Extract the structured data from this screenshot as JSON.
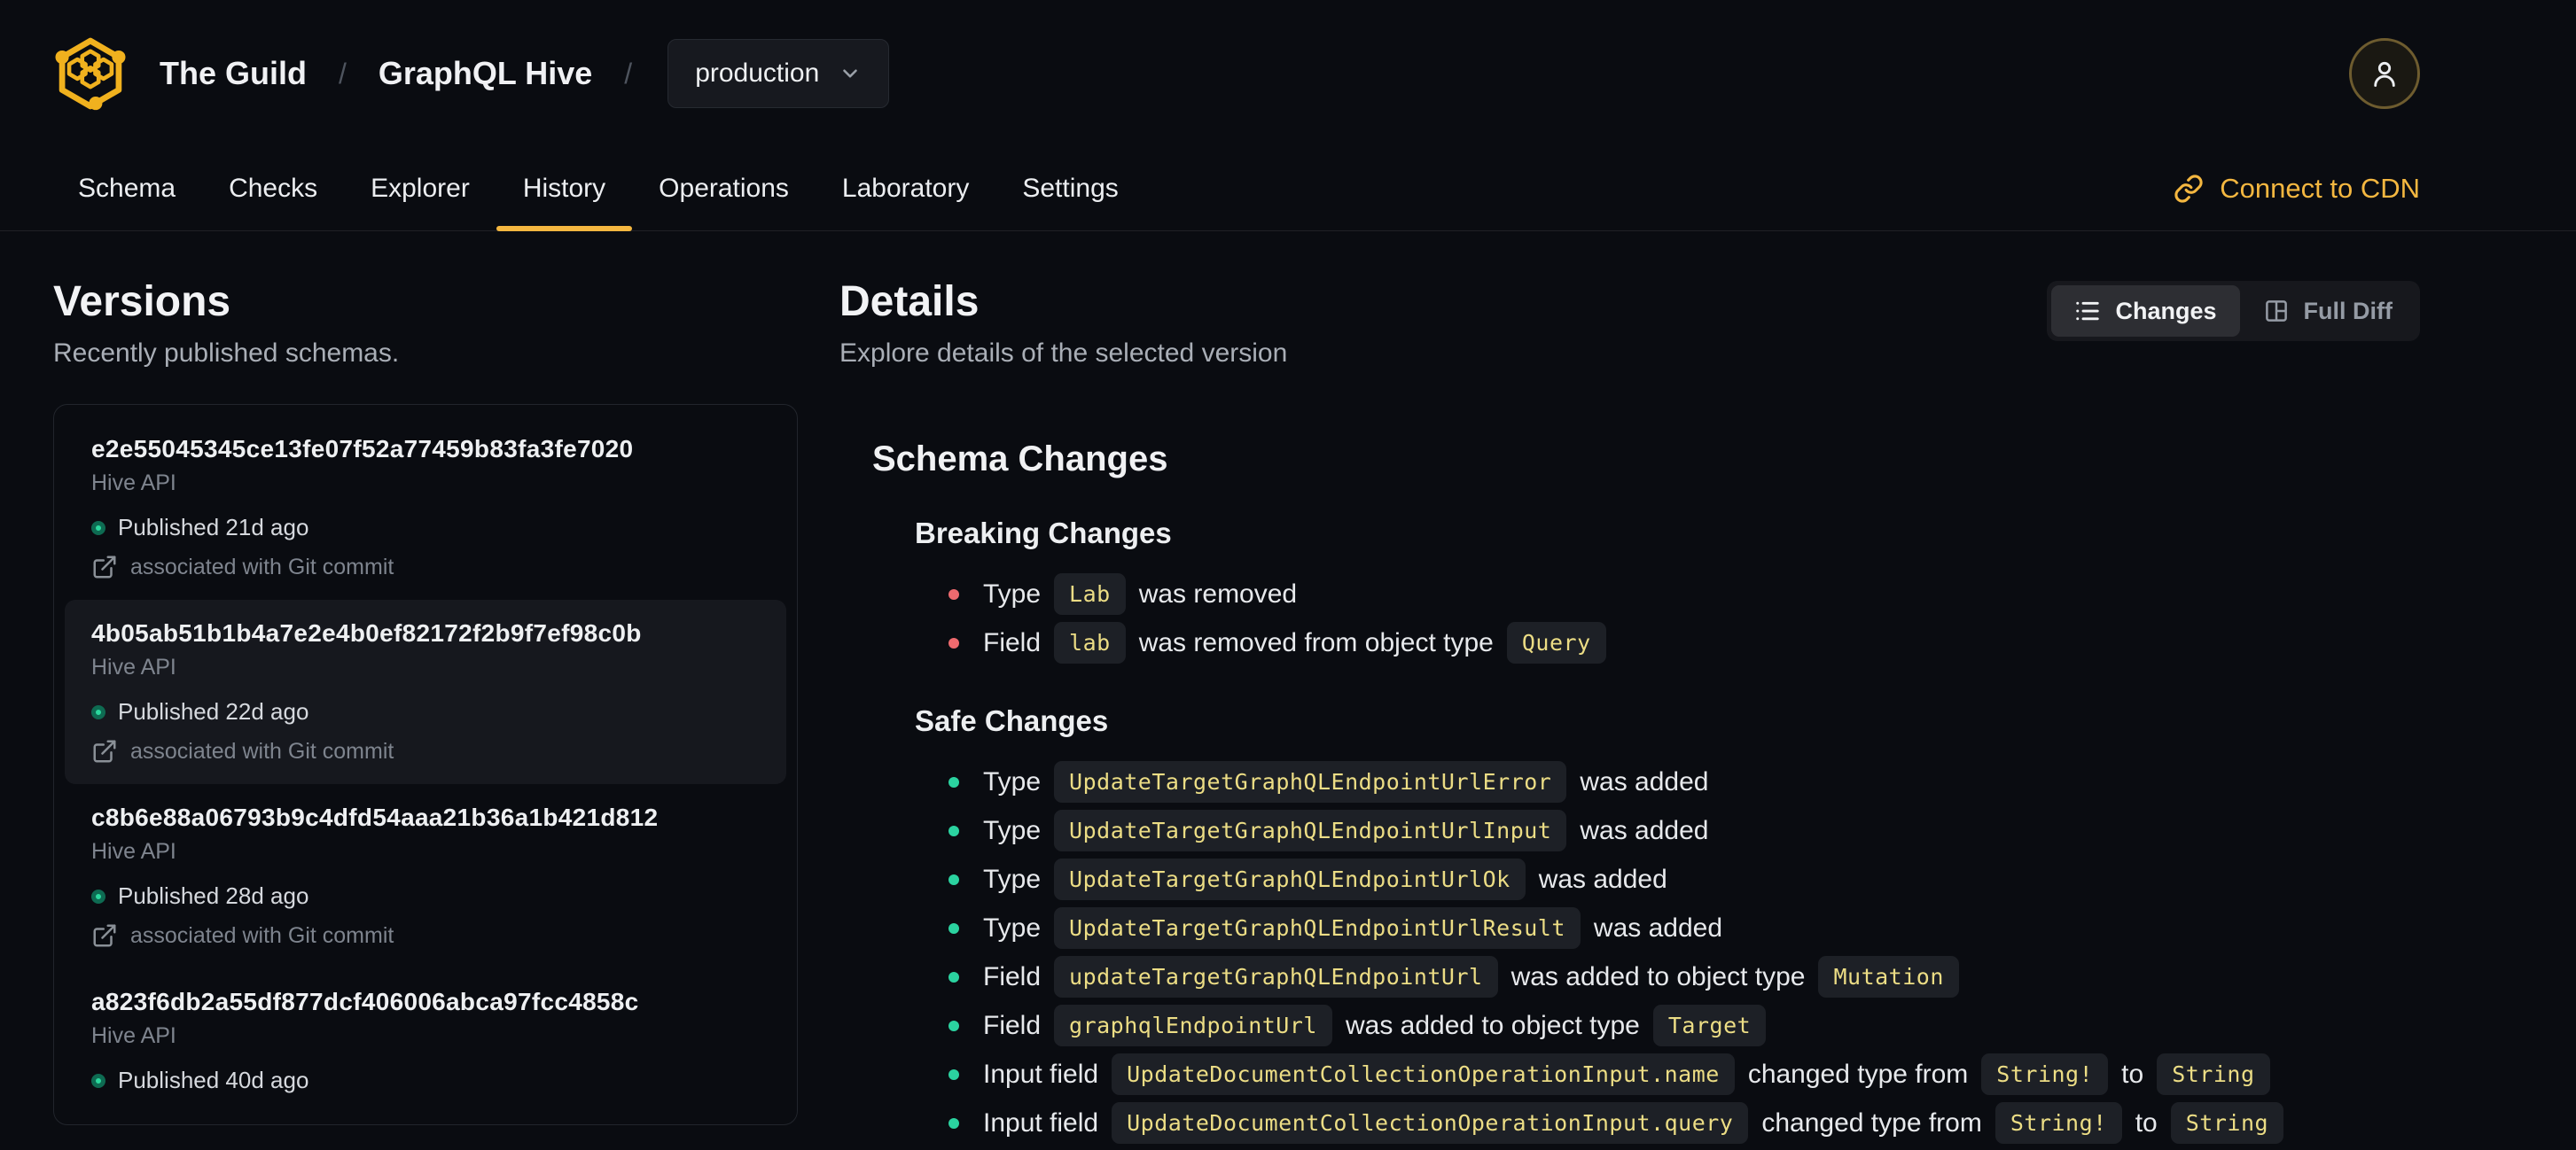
{
  "colors": {
    "accent": "#f4b740",
    "breaking_bullet": "#ee6a6e",
    "safe_bullet": "#2bd3a0",
    "code_text": "#ecdd85",
    "published_dot": "#2bd99e"
  },
  "header": {
    "logo_icon": "hive-logo-icon",
    "breadcrumb": {
      "org": "The Guild",
      "separator": "/",
      "project": "GraphQL Hive",
      "target": {
        "label": "production",
        "icon": "chevron-down-icon"
      }
    },
    "avatar_icon": "user-icon",
    "tabs": [
      {
        "label": "Schema",
        "active": false
      },
      {
        "label": "Checks",
        "active": false
      },
      {
        "label": "Explorer",
        "active": false
      },
      {
        "label": "History",
        "active": true
      },
      {
        "label": "Operations",
        "active": false
      },
      {
        "label": "Laboratory",
        "active": false
      },
      {
        "label": "Settings",
        "active": false
      }
    ],
    "connect_cdn": {
      "label": "Connect to CDN",
      "icon": "link-icon"
    }
  },
  "versions": {
    "title": "Versions",
    "subtitle": "Recently published schemas.",
    "cards": [
      {
        "hash": "e2e55045345ce13fe07f52a77459b83fa3fe7020",
        "service": "Hive API",
        "published": "Published 21d ago",
        "git": "associated with Git commit",
        "selected": false
      },
      {
        "hash": "4b05ab51b1b4a7e2e4b0ef82172f2b9f7ef98c0b",
        "service": "Hive API",
        "published": "Published 22d ago",
        "git": "associated with Git commit",
        "selected": true
      },
      {
        "hash": "c8b6e88a06793b9c4dfd54aaa21b36a1b421d812",
        "service": "Hive API",
        "published": "Published 28d ago",
        "git": "associated with Git commit",
        "selected": false
      },
      {
        "hash": "a823f6db2a55df877dcf406006abca97fcc4858c",
        "service": "Hive API",
        "published": "Published 40d ago",
        "git": null,
        "selected": false
      }
    ]
  },
  "details": {
    "title": "Details",
    "subtitle": "Explore details of the selected version",
    "toggle": {
      "changes": {
        "label": "Changes",
        "icon": "list-icon",
        "active": true
      },
      "full_diff": {
        "label": "Full Diff",
        "icon": "columns-icon",
        "active": false
      }
    },
    "schema_changes_title": "Schema Changes",
    "sections": [
      {
        "title": "Breaking Changes",
        "severity": "breaking",
        "items": [
          {
            "parts": [
              {
                "k": "text",
                "v": "Type"
              },
              {
                "k": "code",
                "v": "Lab"
              },
              {
                "k": "text",
                "v": "was removed"
              }
            ]
          },
          {
            "parts": [
              {
                "k": "text",
                "v": "Field"
              },
              {
                "k": "code",
                "v": "lab"
              },
              {
                "k": "text",
                "v": "was removed from object type"
              },
              {
                "k": "code",
                "v": "Query"
              }
            ]
          }
        ]
      },
      {
        "title": "Safe Changes",
        "severity": "safe",
        "items": [
          {
            "parts": [
              {
                "k": "text",
                "v": "Type"
              },
              {
                "k": "code",
                "v": "UpdateTargetGraphQLEndpointUrlError"
              },
              {
                "k": "text",
                "v": "was added"
              }
            ]
          },
          {
            "parts": [
              {
                "k": "text",
                "v": "Type"
              },
              {
                "k": "code",
                "v": "UpdateTargetGraphQLEndpointUrlInput"
              },
              {
                "k": "text",
                "v": "was added"
              }
            ]
          },
          {
            "parts": [
              {
                "k": "text",
                "v": "Type"
              },
              {
                "k": "code",
                "v": "UpdateTargetGraphQLEndpointUrlOk"
              },
              {
                "k": "text",
                "v": "was added"
              }
            ]
          },
          {
            "parts": [
              {
                "k": "text",
                "v": "Type"
              },
              {
                "k": "code",
                "v": "UpdateTargetGraphQLEndpointUrlResult"
              },
              {
                "k": "text",
                "v": "was added"
              }
            ]
          },
          {
            "parts": [
              {
                "k": "text",
                "v": "Field"
              },
              {
                "k": "code",
                "v": "updateTargetGraphQLEndpointUrl"
              },
              {
                "k": "text",
                "v": "was added to object type"
              },
              {
                "k": "code",
                "v": "Mutation"
              }
            ]
          },
          {
            "parts": [
              {
                "k": "text",
                "v": "Field"
              },
              {
                "k": "code",
                "v": "graphqlEndpointUrl"
              },
              {
                "k": "text",
                "v": "was added to object type"
              },
              {
                "k": "code",
                "v": "Target"
              }
            ]
          },
          {
            "parts": [
              {
                "k": "text",
                "v": "Input field"
              },
              {
                "k": "code",
                "v": "UpdateDocumentCollectionOperationInput.name"
              },
              {
                "k": "text",
                "v": "changed type from"
              },
              {
                "k": "code",
                "v": "String!"
              },
              {
                "k": "text",
                "v": "to"
              },
              {
                "k": "code",
                "v": "String"
              }
            ]
          },
          {
            "parts": [
              {
                "k": "text",
                "v": "Input field"
              },
              {
                "k": "code",
                "v": "UpdateDocumentCollectionOperationInput.query"
              },
              {
                "k": "text",
                "v": "changed type from"
              },
              {
                "k": "code",
                "v": "String!"
              },
              {
                "k": "text",
                "v": "to"
              },
              {
                "k": "code",
                "v": "String"
              }
            ]
          }
        ]
      }
    ]
  }
}
